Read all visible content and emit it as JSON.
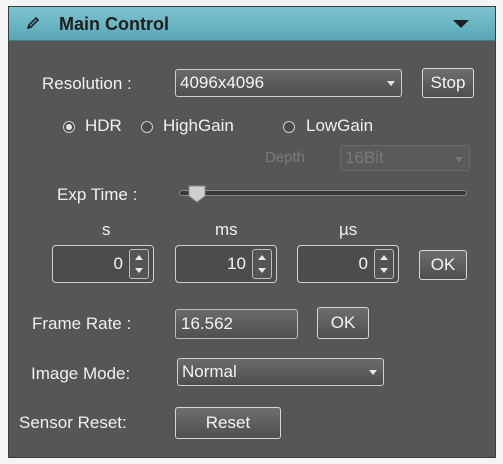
{
  "header": {
    "title": "Main Control",
    "icon": "pencil-icon",
    "collapse_icon": "triangle-down-icon"
  },
  "resolution": {
    "label": "Resolution :",
    "value": "4096x4096",
    "stop_label": "Stop"
  },
  "modes": [
    {
      "label": "HDR",
      "checked": true
    },
    {
      "label": "HighGain",
      "checked": false
    },
    {
      "label": "LowGain",
      "checked": false
    }
  ],
  "depth": {
    "label": "Depth",
    "value": "16Bit"
  },
  "exposure": {
    "label": "Exp Time :",
    "slider_fraction": 0.03,
    "units": {
      "s": {
        "label": "s",
        "value": "0"
      },
      "ms": {
        "label": "ms",
        "value": "10"
      },
      "us": {
        "label": "µs",
        "value": "0"
      }
    },
    "ok_label": "OK"
  },
  "frame_rate": {
    "label": "Frame Rate :",
    "value": "16.562",
    "ok_label": "OK"
  },
  "image_mode": {
    "label": "Image Mode:",
    "value": "Normal"
  },
  "sensor_reset": {
    "label": "Sensor Reset:",
    "button_label": "Reset"
  },
  "colors": {
    "header": "#6bb6c4",
    "panel": "#565656",
    "text": "#f0f0f0"
  }
}
